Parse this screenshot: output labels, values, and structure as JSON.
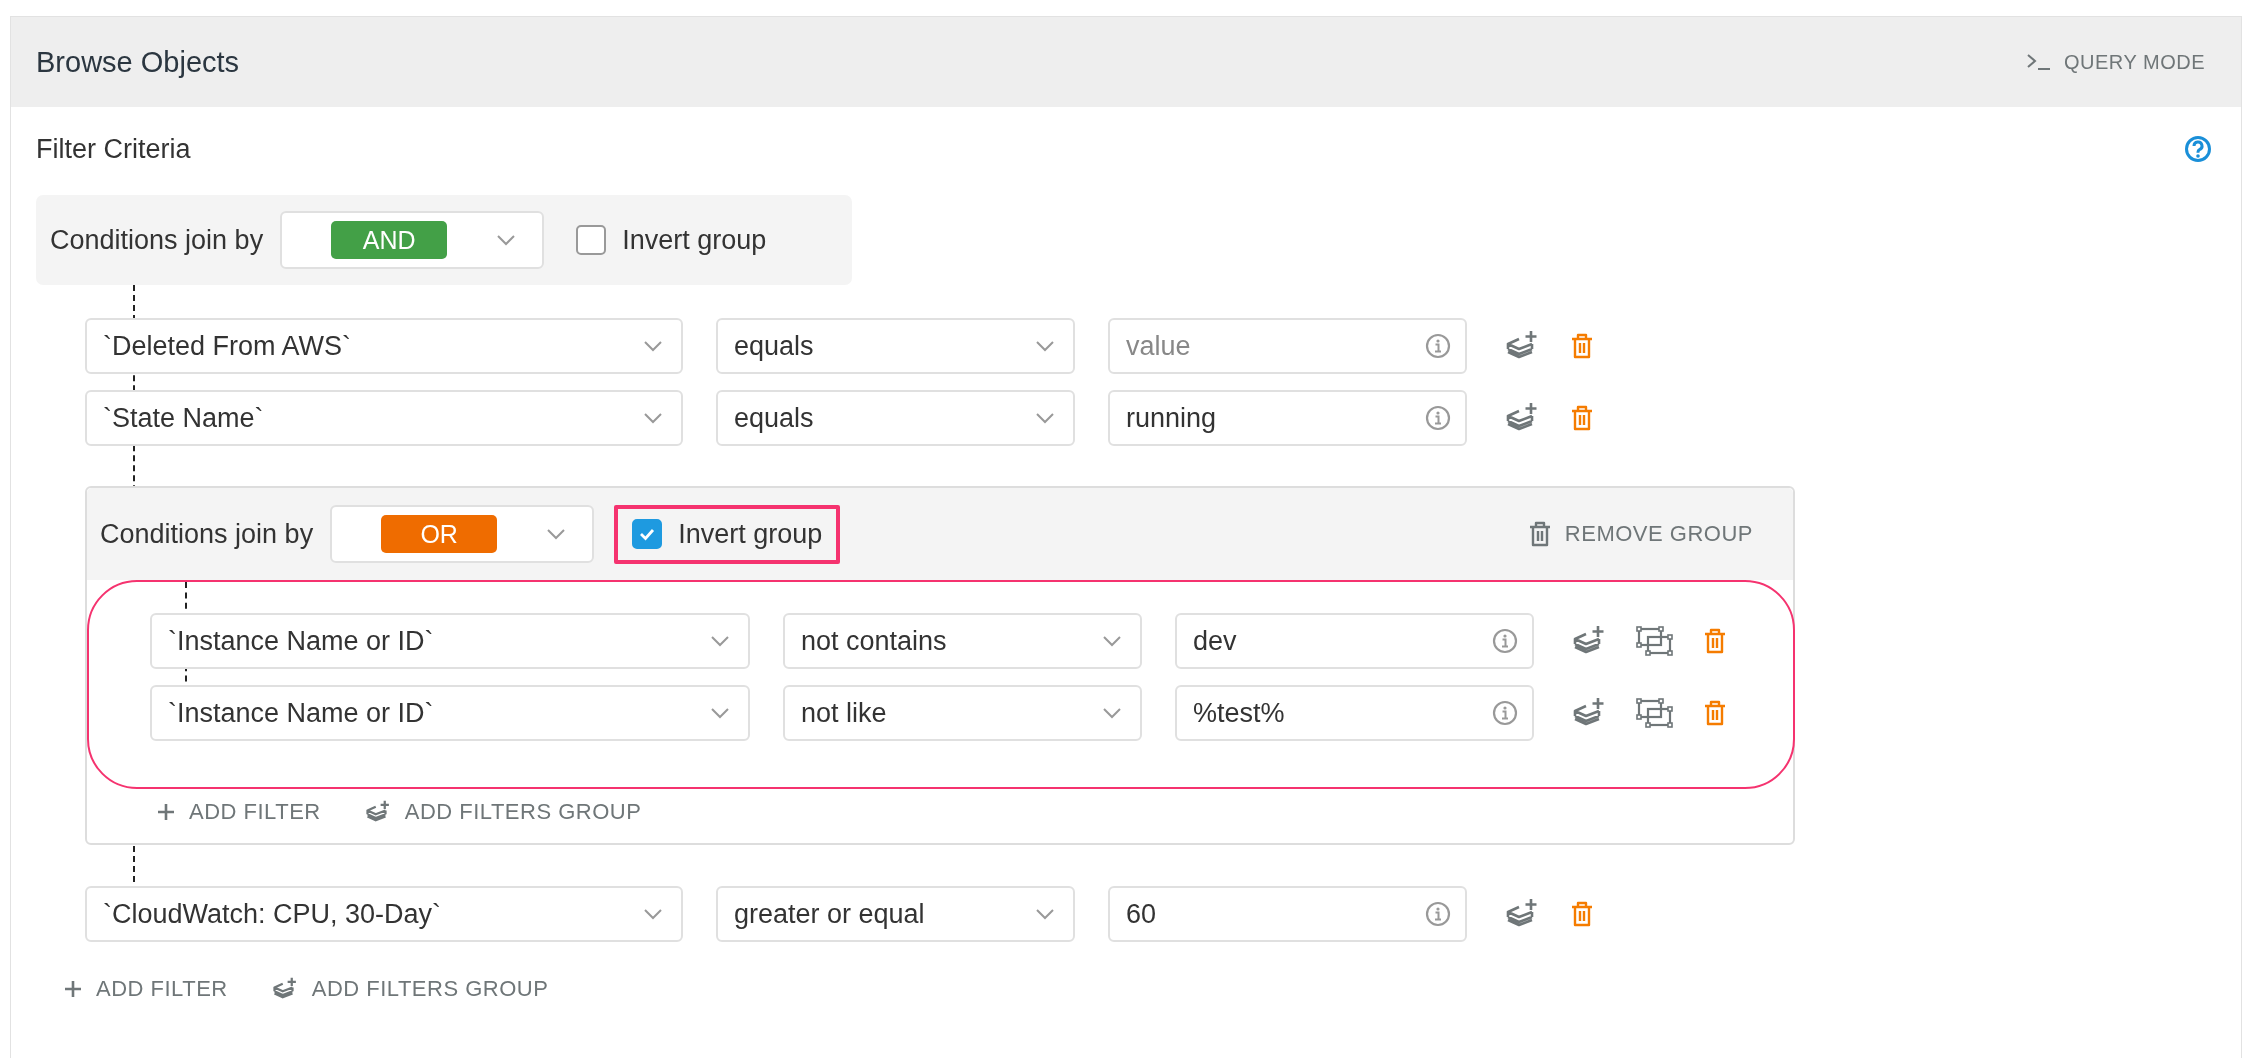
{
  "panel": {
    "title": "Browse Objects",
    "query_mode": "QUERY MODE"
  },
  "filter_criteria": {
    "label": "Filter Criteria"
  },
  "root_group": {
    "join_label": "Conditions join by",
    "join": "AND",
    "color": "#43a047",
    "invert_label": "Invert group",
    "invert": false,
    "items": [
      {
        "kind": "filter",
        "field": "`Deleted From AWS`",
        "operator": "equals",
        "placeholder": "value"
      },
      {
        "kind": "filter",
        "field": "`State Name`",
        "operator": "equals",
        "value": "running"
      },
      {
        "kind": "group",
        "join_label": "Conditions join by",
        "join": "OR",
        "color": "#ef6c00",
        "invert_label": "Invert group",
        "invert": true,
        "invert_highlighted": true,
        "remove_label": "REMOVE GROUP",
        "conditions_highlighted": true,
        "items": [
          {
            "kind": "filter",
            "field": "`Instance Name or ID`",
            "operator": "not contains",
            "value": "dev",
            "group_action": true
          },
          {
            "kind": "filter",
            "field": "`Instance Name or ID`",
            "operator": "not like",
            "value": "%test%",
            "group_action": true
          }
        ],
        "add_filter": "ADD FILTER",
        "add_group": "ADD FILTERS GROUP"
      },
      {
        "kind": "filter",
        "field": "`CloudWatch: CPU, 30-Day`",
        "operator": "greater or equal",
        "value": "60"
      }
    ],
    "add_filter": "ADD FILTER",
    "add_group": "ADD FILTERS GROUP"
  }
}
